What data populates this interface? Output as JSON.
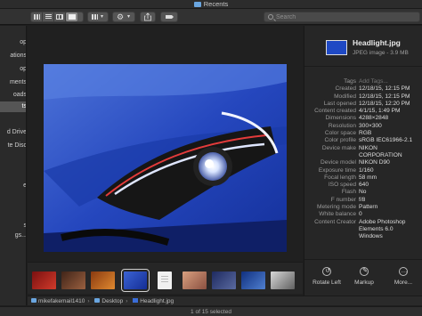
{
  "window": {
    "title": "Recents"
  },
  "toolbar": {
    "view_modes": [
      "icon-view",
      "list-view",
      "column-view",
      "gallery-view"
    ],
    "group_menu_icon": "grid-dropdown-icon",
    "action_menu_icon": "gear-icon",
    "share_icon": "share-icon",
    "tag_icon": "tag-icon"
  },
  "search": {
    "placeholder": "Search"
  },
  "sidebar": {
    "items": [
      {
        "label": "Desktop",
        "visible": "op"
      },
      {
        "label": "Applications",
        "visible": "ations"
      },
      {
        "label": "Desktop",
        "visible": "op"
      },
      {
        "label": "Documents",
        "visible": "ments"
      },
      {
        "label": "Downloads",
        "visible": "oads"
      },
      {
        "label": "Recents",
        "visible": "ts",
        "selected": true
      },
      {
        "label": "iCloud Drive",
        "visible": "d Drive"
      },
      {
        "label": "Remote Disc",
        "visible": "te Disc"
      },
      {
        "label": "Home",
        "visible": "e"
      },
      {
        "label": "Tags",
        "visible": "s"
      },
      {
        "label": "All Tags…",
        "visible": "gs..."
      }
    ]
  },
  "preview": {
    "name": "Headlight.jpg"
  },
  "thumbnails": [
    {
      "name": "thumb-red"
    },
    {
      "name": "thumb-people"
    },
    {
      "name": "thumb-orange"
    },
    {
      "name": "thumb-headlight",
      "selected": true
    },
    {
      "name": "thumb-document"
    },
    {
      "name": "thumb-skin"
    },
    {
      "name": "thumb-car"
    },
    {
      "name": "thumb-screen"
    },
    {
      "name": "thumb-landscape"
    },
    {
      "name": "thumb-window"
    }
  ],
  "pathbar": {
    "segments": [
      "mikefakemail1410",
      "Desktop",
      "Headlight.jpg"
    ]
  },
  "status": {
    "text": "1 of 15 selected"
  },
  "inspector": {
    "filename": "Headlight.jpg",
    "subtitle": "JPEG image - 3.9 MB",
    "metadata": [
      {
        "key": "Tags",
        "value": "Add Tags...",
        "placeholder": true
      },
      {
        "key": "Created",
        "value": "12/18/15, 12:15 PM"
      },
      {
        "key": "Modified",
        "value": "12/18/15, 12:15 PM"
      },
      {
        "key": "Last opened",
        "value": "12/18/15, 12:20 PM"
      },
      {
        "key": "Content created",
        "value": "4/1/15, 1:49 PM"
      },
      {
        "key": "Dimensions",
        "value": "4288×2848"
      },
      {
        "key": "Resolution",
        "value": "300×300"
      },
      {
        "key": "Color space",
        "value": "RGB"
      },
      {
        "key": "Color profile",
        "value": "sRGB IEC61966-2.1"
      },
      {
        "key": "Device make",
        "value": "NIKON\nCORPORATION"
      },
      {
        "key": "Device model",
        "value": "NIKON D90"
      },
      {
        "key": "Exposure time",
        "value": "1/160"
      },
      {
        "key": "Focal length",
        "value": "58 mm"
      },
      {
        "key": "ISO speed",
        "value": "640"
      },
      {
        "key": "Flash",
        "value": "No"
      },
      {
        "key": "F number",
        "value": "f/8"
      },
      {
        "key": "Metering mode",
        "value": "Pattern"
      },
      {
        "key": "White balance",
        "value": "0"
      },
      {
        "key": "Content Creator",
        "value": "Adobe Photoshop\nElements 6.0\nWindows"
      }
    ],
    "actions": [
      {
        "label": "Rotate Left",
        "icon": "rotate-left-icon"
      },
      {
        "label": "Markup",
        "icon": "markup-icon"
      },
      {
        "label": "More...",
        "icon": "more-icon"
      }
    ]
  },
  "colors": {
    "accent": "#3a6dd8",
    "folder": "#6aa6e0",
    "background": "#1e1e1e"
  }
}
